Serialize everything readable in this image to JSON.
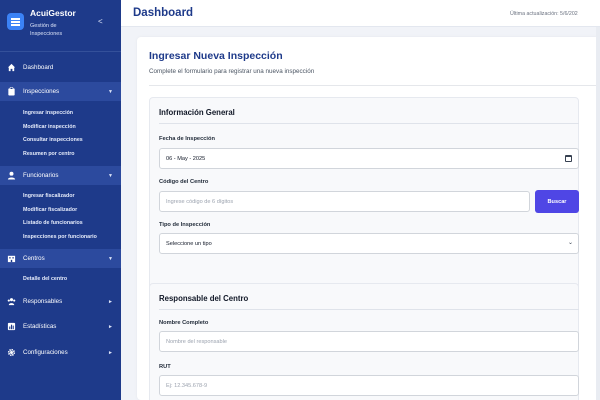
{
  "brand": {
    "name": "AcuiGestor",
    "subtitle": "Gestión de Inspecciones",
    "collapse": "<"
  },
  "sidebar": {
    "items": [
      {
        "label": "Dashboard",
        "icon": "home-icon"
      },
      {
        "label": "Inspecciones",
        "icon": "clipboard-icon",
        "arrow": "▼",
        "subitems": [
          "Ingresar inspección",
          "Modificar inspección",
          "Consultar inspecciones",
          "Resumen por centro"
        ]
      },
      {
        "label": "Funcionarios",
        "icon": "user-icon",
        "arrow": "▼",
        "subitems": [
          "Ingresar fiscalizador",
          "Modificar fiscalizador",
          "Listado de funcionarios",
          "Inspecciones por funcionario"
        ]
      },
      {
        "label": "Centros",
        "icon": "building-icon",
        "arrow": "▼",
        "subitems": [
          "Detalle del centro"
        ]
      },
      {
        "label": "Responsables",
        "icon": "users-icon",
        "arrow": "►"
      },
      {
        "label": "Estadísticas",
        "icon": "chart-icon",
        "arrow": "►"
      },
      {
        "label": "Configuraciones",
        "icon": "gear-icon",
        "arrow": "►"
      }
    ]
  },
  "header": {
    "title": "Dashboard",
    "last_update": "Última actualización: 5/6/202"
  },
  "form": {
    "title": "Ingresar Nueva Inspección",
    "subtitle": "Complete el formulario para registrar una nueva inspección",
    "general": {
      "title": "Información General",
      "date_label": "Fecha de Inspección",
      "date_value": "06 - May - 2025",
      "code_label": "Código del Centro",
      "code_placeholder": "Ingrese código de 6 dígitos",
      "search_button": "Buscar",
      "type_label": "Tipo de Inspección",
      "type_value": "Seleccione un tipo"
    },
    "responsible": {
      "title": "Responsable del Centro",
      "name_label": "Nombre Completo",
      "name_placeholder": "Nombre del responsable",
      "rut_label": "RUT",
      "rut_placeholder": "Ej: 12.345.678-9"
    }
  },
  "colors": {
    "sidebar": "#1e3a8a",
    "accent": "#4f46e5",
    "title": "#1e3a8a"
  }
}
